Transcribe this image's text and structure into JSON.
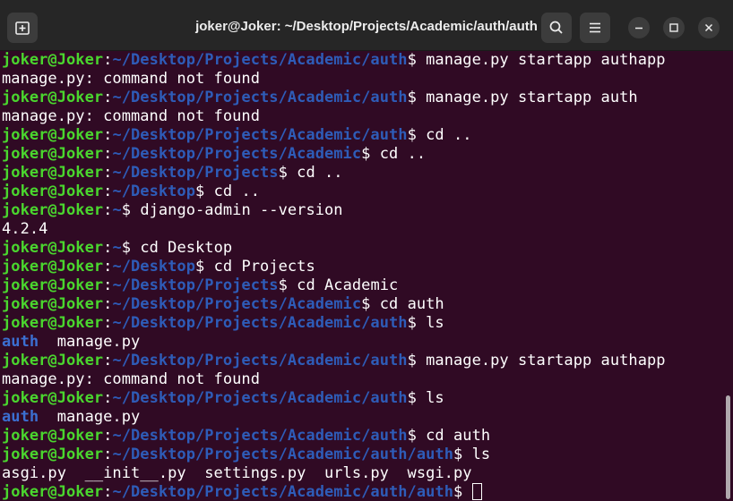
{
  "window": {
    "title": "joker@Joker: ~/Desktop/Projects/Academic/auth/auth"
  },
  "icons": {
    "new_tab": "new-tab-icon",
    "search": "search-icon",
    "menu": "hamburger-menu-icon",
    "minimize": "minimize-icon",
    "maximize": "maximize-icon",
    "close": "close-icon"
  },
  "colors": {
    "background": "#300a24",
    "user_host": "#4ad62e",
    "path": "#2e5cb8",
    "directory": "#3b6fd1",
    "text": "#ffffff"
  },
  "terminal": {
    "user": "joker@Joker",
    "lines": [
      {
        "type": "prompt",
        "path": "~/Desktop/Projects/Academic/auth",
        "cmd": " manage.py startapp authapp"
      },
      {
        "type": "output",
        "text": "manage.py: command not found"
      },
      {
        "type": "prompt",
        "path": "~/Desktop/Projects/Academic/auth",
        "cmd": " manage.py startapp auth"
      },
      {
        "type": "output",
        "text": "manage.py: command not found"
      },
      {
        "type": "prompt",
        "path": "~/Desktop/Projects/Academic/auth",
        "cmd": " cd .."
      },
      {
        "type": "prompt",
        "path": "~/Desktop/Projects/Academic",
        "cmd": " cd .."
      },
      {
        "type": "prompt",
        "path": "~/Desktop/Projects",
        "cmd": " cd .."
      },
      {
        "type": "prompt",
        "path": "~/Desktop",
        "cmd": " cd .."
      },
      {
        "type": "prompt",
        "path": "~",
        "cmd": " django-admin --version"
      },
      {
        "type": "output",
        "text": "4.2.4"
      },
      {
        "type": "prompt",
        "path": "~",
        "cmd": " cd Desktop"
      },
      {
        "type": "prompt",
        "path": "~/Desktop",
        "cmd": " cd Projects"
      },
      {
        "type": "prompt",
        "path": "~/Desktop/Projects",
        "cmd": " cd Academic"
      },
      {
        "type": "prompt",
        "path": "~/Desktop/Projects/Academic",
        "cmd": " cd auth"
      },
      {
        "type": "prompt",
        "path": "~/Desktop/Projects/Academic/auth",
        "cmd": " ls"
      },
      {
        "type": "listing",
        "dir": "auth",
        "rest": "  manage.py"
      },
      {
        "type": "prompt",
        "path": "~/Desktop/Projects/Academic/auth",
        "cmd": " manage.py startapp authapp"
      },
      {
        "type": "output",
        "text": "manage.py: command not found"
      },
      {
        "type": "prompt",
        "path": "~/Desktop/Projects/Academic/auth",
        "cmd": " ls"
      },
      {
        "type": "listing",
        "dir": "auth",
        "rest": "  manage.py"
      },
      {
        "type": "prompt",
        "path": "~/Desktop/Projects/Academic/auth",
        "cmd": " cd auth"
      },
      {
        "type": "prompt",
        "path": "~/Desktop/Projects/Academic/auth/auth",
        "cmd": " ls"
      },
      {
        "type": "output",
        "text": "asgi.py  __init__.py  settings.py  urls.py  wsgi.py"
      },
      {
        "type": "prompt",
        "path": "~/Desktop/Projects/Academic/auth/auth",
        "cmd": " ",
        "cursor": true
      }
    ]
  }
}
